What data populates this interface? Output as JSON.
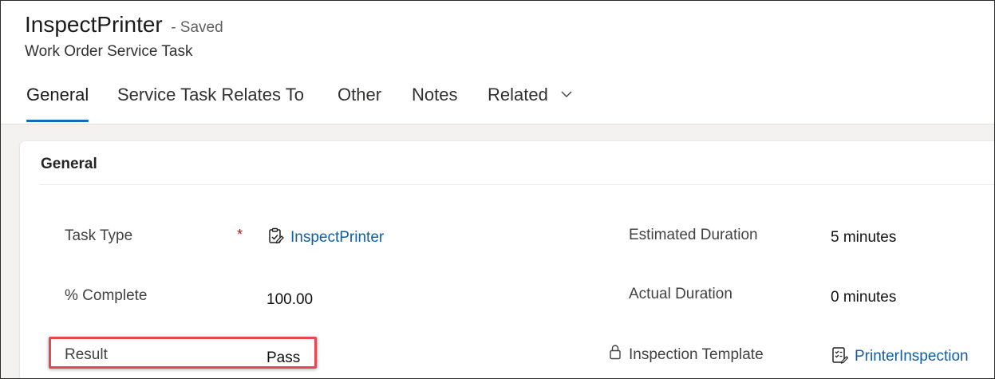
{
  "header": {
    "title": "InspectPrinter",
    "saved_status": "- Saved",
    "entity_name": "Work Order Service Task"
  },
  "tabs": [
    {
      "label": "General",
      "active": true
    },
    {
      "label": "Service Task Relates To",
      "active": false
    },
    {
      "label": "Other",
      "active": false
    },
    {
      "label": "Notes",
      "active": false
    },
    {
      "label": "Related",
      "active": false
    }
  ],
  "section": {
    "title": "General",
    "fields": {
      "task_type": {
        "label": "Task Type",
        "required_marker": "*",
        "value": "InspectPrinter",
        "icon": "task-type-icon"
      },
      "percent_complete": {
        "label": "% Complete",
        "value": "100.00"
      },
      "result": {
        "label": "Result",
        "value": "Pass",
        "highlighted": true
      },
      "estimated_duration": {
        "label": "Estimated Duration",
        "value": "5 minutes"
      },
      "actual_duration": {
        "label": "Actual Duration",
        "value": "0 minutes"
      },
      "inspection_template": {
        "label": "Inspection Template",
        "value": "PrinterInspection",
        "locked": true,
        "icon": "inspection-icon"
      }
    }
  },
  "colors": {
    "accent": "#0f6cbd",
    "link": "#115ea3",
    "required": "#c50f1f",
    "highlight_border": "#e8474d",
    "page_background": "#f3f2f1"
  }
}
